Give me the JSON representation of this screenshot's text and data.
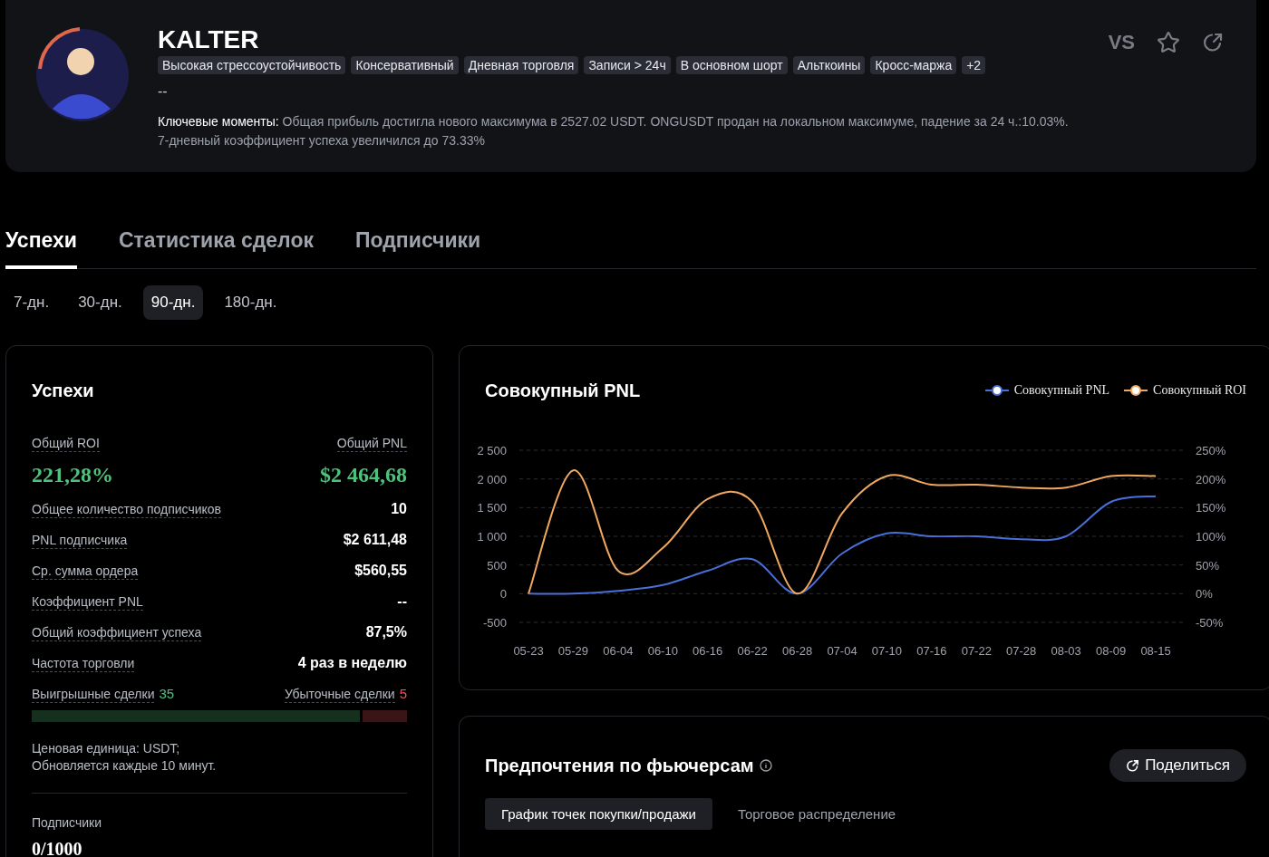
{
  "profile": {
    "name": "KALTER",
    "tags": [
      "Высокая стрессоустойчивость",
      "Консервативный",
      "Дневная торговля",
      "Записи > 24ч",
      "В основном шорт",
      "Альткоины",
      "Кросс-маржа",
      "+2"
    ],
    "bio": "--",
    "highlights_label": "Ключевые моменты:",
    "highlights": "Общая прибыль достигла нового максимума в 2527.02 USDT. ONGUSDT продан на локальном максимуме, падение за 24 ч.:10.03%.",
    "highlights_2": "7-дневный коэффициент успеха увеличился до 73.33%",
    "compare_label": "VS"
  },
  "tabs": [
    {
      "label": "Успехи",
      "selected": true
    },
    {
      "label": "Статистика сделок",
      "selected": false
    },
    {
      "label": "Подписчики",
      "selected": false
    }
  ],
  "periods": [
    {
      "label": "7-дн.",
      "selected": false
    },
    {
      "label": "30-дн.",
      "selected": false
    },
    {
      "label": "90-дн.",
      "selected": true
    },
    {
      "label": "180-дн.",
      "selected": false
    }
  ],
  "performance": {
    "title": "Успехи",
    "roi_label": "Общий ROI",
    "roi": "221,28%",
    "pnl_label": "Общий PNL",
    "pnl": "$2 464,68",
    "stats": [
      {
        "label": "Общее количество подписчиков",
        "value": "10"
      },
      {
        "label": "PNL подписчика",
        "value": "$2 611,48"
      },
      {
        "label": "Ср. сумма ордера",
        "value": "$560,55"
      },
      {
        "label": "Коэффициент PNL",
        "value": "--"
      },
      {
        "label": "Общий коэффициент успеха",
        "value": "87,5%"
      },
      {
        "label": "Частота торговли",
        "value": "4 раз в неделю"
      }
    ],
    "wins_label": "Выигрышные сделки",
    "wins": "35",
    "losses_label": "Убыточные сделки",
    "losses": "5",
    "level": 0.875,
    "note_1": "Ценовая единица: USDT;",
    "note_2": "Обновляется каждые 10 минут.",
    "subscribers_label": "Подписчики",
    "subscribers": "0/1000"
  },
  "pnl_chart": {
    "title": "Совокупный PNL",
    "chart_data": {
      "type": "line",
      "x": [
        "05-23",
        "05-29",
        "06-04",
        "06-10",
        "06-16",
        "06-22",
        "06-28",
        "07-04",
        "07-10",
        "07-16",
        "07-22",
        "07-28",
        "08-03",
        "08-09",
        "08-15"
      ],
      "series": [
        {
          "name": "Совокупный PNL",
          "color": "#4a6fd8",
          "values": [
            0,
            0,
            50,
            150,
            400,
            600,
            0,
            700,
            1050,
            1000,
            1000,
            950,
            1000,
            1600,
            1700
          ]
        },
        {
          "name": "Совокупный ROI",
          "color": "#f0a860",
          "axis": "y2",
          "values": [
            0,
            215,
            40,
            80,
            165,
            160,
            0,
            140,
            205,
            190,
            190,
            185,
            185,
            205,
            205
          ]
        }
      ],
      "grid": true,
      "ylim": [
        -500,
        2500
      ],
      "y2lim": [
        -50,
        250
      ],
      "yticks": [
        {
          "value": -500,
          "label": "-500"
        },
        {
          "value": 0,
          "label": "0"
        },
        {
          "value": 500,
          "label": "500"
        },
        {
          "value": 1000,
          "label": "1 000"
        },
        {
          "value": 1500,
          "label": "1 500"
        },
        {
          "value": 2000,
          "label": "2 000"
        },
        {
          "value": 2500,
          "label": "2 500"
        }
      ],
      "y2ticks": [
        {
          "value": -50,
          "label": "-50%"
        },
        {
          "value": 0,
          "label": "0%"
        },
        {
          "value": 50,
          "label": "50%"
        },
        {
          "value": 100,
          "label": "100%"
        },
        {
          "value": 150,
          "label": "150%"
        },
        {
          "value": 200,
          "label": "200%"
        },
        {
          "value": 250,
          "label": "250%"
        }
      ]
    }
  },
  "futures": {
    "title": "Предпочтения по фьючерсам",
    "share_label": "Поделиться",
    "tabs": [
      {
        "label": "График точек покупки/продажи",
        "selected": true
      },
      {
        "label": "Торговое распределение",
        "selected": false
      }
    ]
  }
}
